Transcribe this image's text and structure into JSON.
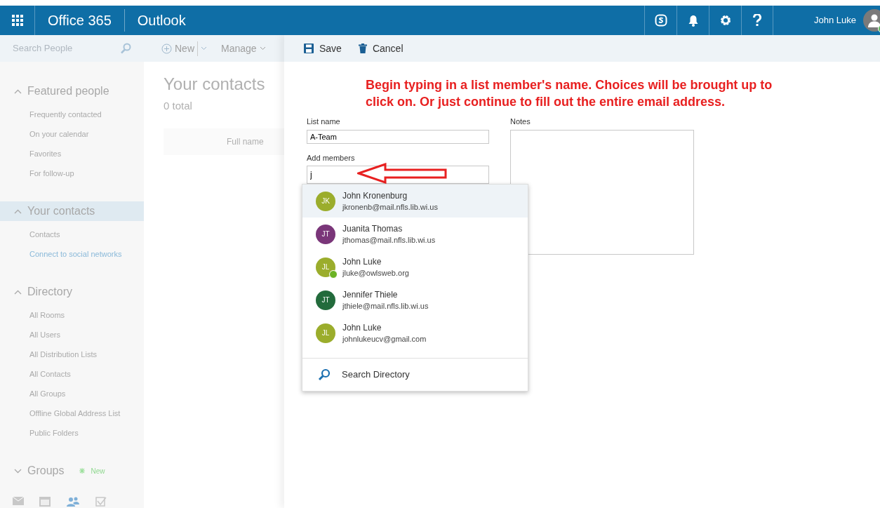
{
  "header": {
    "app_suite": "Office 365",
    "app": "Outlook",
    "user": "John Luke"
  },
  "sidebar": {
    "search": {
      "placeholder": "Search People"
    },
    "sections": [
      {
        "title": "Featured people",
        "expanded": true,
        "selected": false,
        "items": [
          "Frequently contacted",
          "On your calendar",
          "Favorites",
          "For follow-up"
        ]
      },
      {
        "title": "Your contacts",
        "expanded": true,
        "selected": true,
        "items": [
          "Contacts",
          "Connect to social networks"
        ]
      },
      {
        "title": "Directory",
        "expanded": true,
        "selected": false,
        "items": [
          "All Rooms",
          "All Users",
          "All Distribution Lists",
          "All Contacts",
          "All Groups",
          "Offline Global Address List",
          "Public Folders"
        ]
      },
      {
        "title": "Groups",
        "expanded": false,
        "selected": false,
        "badge": "New"
      }
    ]
  },
  "toolbar": {
    "new": "New",
    "manage": "Manage"
  },
  "contacts": {
    "title": "Your contacts",
    "count": "0 total",
    "column": "Full name"
  },
  "form": {
    "save": "Save",
    "cancel": "Cancel",
    "annotation": "Begin typing in a list member's name. Choices will be brought up to click on. Or just continue to fill out the entire email address.",
    "list_name_label": "List name",
    "list_name": "A-Team",
    "members_label": "Add members",
    "members_value": "j",
    "notes_label": "Notes"
  },
  "suggestions": [
    {
      "initials": "JK",
      "name": "John Kronenburg",
      "email": "jkronenb@mail.nfls.lib.wi.us",
      "color": "#9bad2c",
      "online": false,
      "selected": true
    },
    {
      "initials": "JT",
      "name": "Juanita Thomas",
      "email": "jthomas@mail.nfls.lib.wi.us",
      "color": "#7a3679",
      "online": false,
      "selected": false
    },
    {
      "initials": "JL",
      "name": "John Luke",
      "email": "jluke@owlsweb.org",
      "color": "#9bad2c",
      "online": true,
      "selected": false
    },
    {
      "initials": "JT",
      "name": "Jennifer Thiele",
      "email": "jthiele@mail.nfls.lib.wi.us",
      "color": "#236b3c",
      "online": false,
      "selected": false
    },
    {
      "initials": "JL",
      "name": "John Luke",
      "email": "johnlukeucv@gmail.com",
      "color": "#9bad2c",
      "online": false,
      "selected": false
    }
  ],
  "search_directory": "Search Directory"
}
